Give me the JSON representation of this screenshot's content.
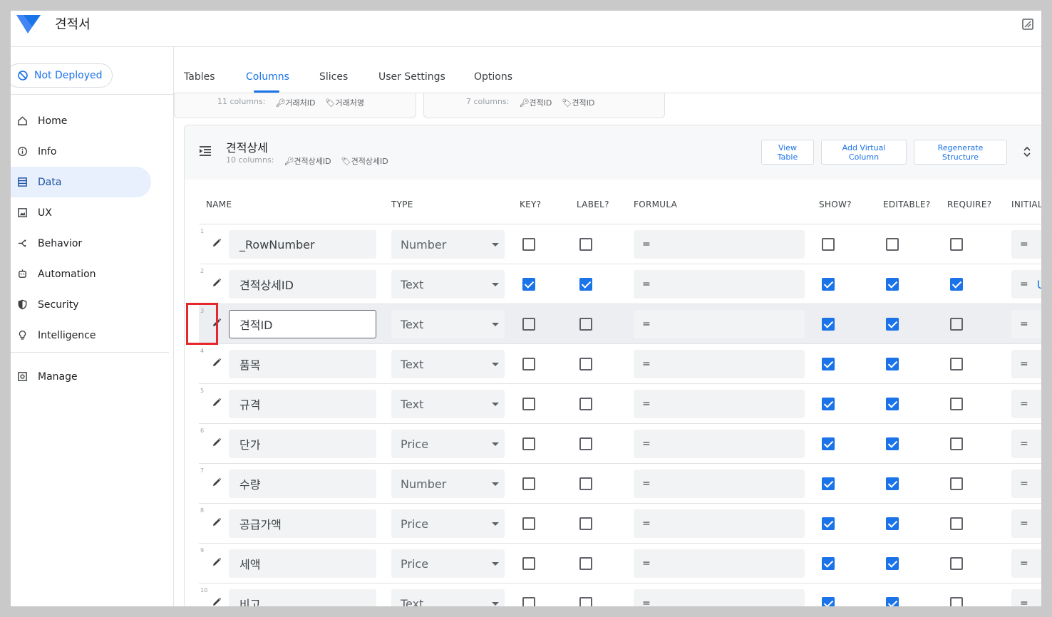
{
  "app": {
    "title": "견적서"
  },
  "deploy": {
    "label": "Not Deployed"
  },
  "sidebar": {
    "items": [
      {
        "label": "Home",
        "icon": "home-icon"
      },
      {
        "label": "Info",
        "icon": "info-icon"
      },
      {
        "label": "Data",
        "icon": "data-icon",
        "active": true
      },
      {
        "label": "UX",
        "icon": "ux-icon"
      },
      {
        "label": "Behavior",
        "icon": "behavior-icon"
      },
      {
        "label": "Automation",
        "icon": "automation-icon"
      },
      {
        "label": "Security",
        "icon": "shield-icon"
      },
      {
        "label": "Intelligence",
        "icon": "bulb-icon"
      }
    ],
    "manage": {
      "label": "Manage",
      "icon": "manage-icon"
    }
  },
  "tabs": [
    "Tables",
    "Columns",
    "Slices",
    "User Settings",
    "Options"
  ],
  "active_tab": "Columns",
  "top_cards": [
    {
      "count": "11 columns:",
      "key": "거래처ID",
      "label": "거래처명"
    },
    {
      "count": "7 columns:",
      "key": "견적ID",
      "label": "견적ID"
    }
  ],
  "table": {
    "title": "견적상세",
    "count": "10 columns:",
    "key": "견적상세ID",
    "label": "견적상세ID",
    "buttons": {
      "view_table": "View Table",
      "add_virtual": "Add Virtual Column",
      "regenerate": "Regenerate Structure"
    },
    "headers": {
      "name": "NAME",
      "type": "TYPE",
      "key": "KEY?",
      "label": "LABEL?",
      "formula": "FORMULA",
      "show": "SHOW?",
      "editable": "EDITABLE?",
      "require": "REQUIRE?",
      "initial": "INITIAL"
    },
    "rows": [
      {
        "num": "1",
        "name": "_RowNumber",
        "type": "Number",
        "key": false,
        "label": false,
        "formula": "=",
        "show": false,
        "editable": false,
        "require": false,
        "initial": "=",
        "initial_extra": ""
      },
      {
        "num": "2",
        "name": "견적상세ID",
        "type": "Text",
        "key": true,
        "label": true,
        "formula": "=",
        "show": true,
        "editable": true,
        "require": true,
        "initial": "=",
        "initial_extra": "UI"
      },
      {
        "num": "3",
        "name": "견적ID",
        "type": "Text",
        "key": false,
        "label": false,
        "formula": "=",
        "show": true,
        "editable": true,
        "require": false,
        "initial": "=",
        "initial_extra": "",
        "highlighted": true
      },
      {
        "num": "4",
        "name": "품목",
        "type": "Text",
        "key": false,
        "label": false,
        "formula": "=",
        "show": true,
        "editable": true,
        "require": false,
        "initial": "=",
        "initial_extra": ""
      },
      {
        "num": "5",
        "name": "규격",
        "type": "Text",
        "key": false,
        "label": false,
        "formula": "=",
        "show": true,
        "editable": true,
        "require": false,
        "initial": "=",
        "initial_extra": ""
      },
      {
        "num": "6",
        "name": "단가",
        "type": "Price",
        "key": false,
        "label": false,
        "formula": "=",
        "show": true,
        "editable": true,
        "require": false,
        "initial": "=",
        "initial_extra": ""
      },
      {
        "num": "7",
        "name": "수량",
        "type": "Number",
        "key": false,
        "label": false,
        "formula": "=",
        "show": true,
        "editable": true,
        "require": false,
        "initial": "=",
        "initial_extra": ""
      },
      {
        "num": "8",
        "name": "공급가액",
        "type": "Price",
        "key": false,
        "label": false,
        "formula": "=",
        "show": true,
        "editable": true,
        "require": false,
        "initial": "=",
        "initial_extra": ""
      },
      {
        "num": "9",
        "name": "세액",
        "type": "Price",
        "key": false,
        "label": false,
        "formula": "=",
        "show": true,
        "editable": true,
        "require": false,
        "initial": "=",
        "initial_extra": ""
      },
      {
        "num": "10",
        "name": "비고",
        "type": "Text",
        "key": false,
        "label": false,
        "formula": "=",
        "show": true,
        "editable": true,
        "require": false,
        "initial": "=",
        "initial_extra": ""
      }
    ]
  },
  "colors": {
    "accent": "#1a73e8",
    "highlight_border": "#e5262b",
    "active_nav_bg": "#e8f0fe"
  }
}
